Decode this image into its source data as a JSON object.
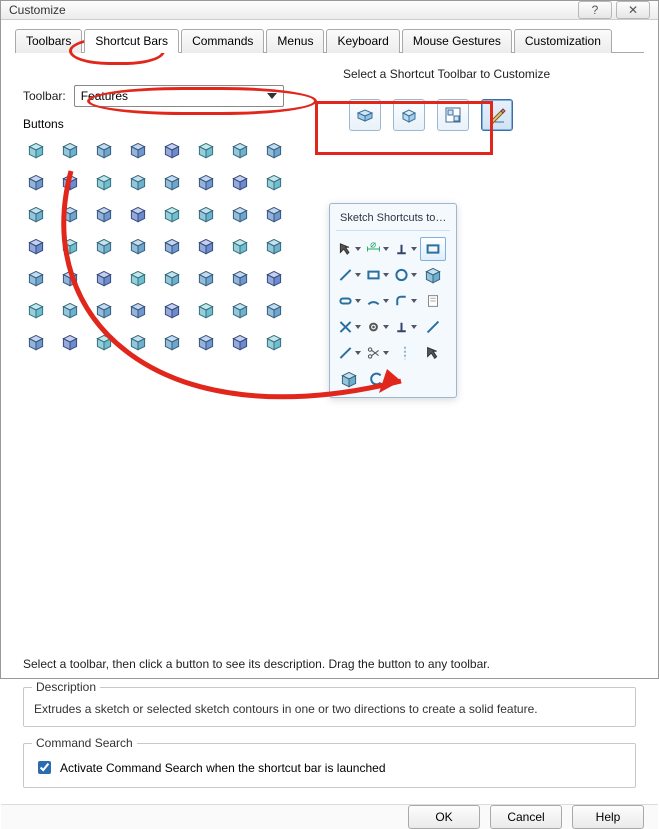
{
  "window": {
    "title": "Customize"
  },
  "tabs": [
    {
      "label": "Toolbars"
    },
    {
      "label": "Shortcut Bars"
    },
    {
      "label": "Commands"
    },
    {
      "label": "Menus"
    },
    {
      "label": "Keyboard"
    },
    {
      "label": "Mouse Gestures"
    },
    {
      "label": "Customization"
    }
  ],
  "active_tab_index": 1,
  "toolbar_select": {
    "label": "Toolbar:",
    "value": "Features"
  },
  "right_panel": {
    "heading": "Select a Shortcut Toolbar to Customize",
    "buttons": [
      {
        "name": "assembly-icon"
      },
      {
        "name": "part-icon"
      },
      {
        "name": "drawing-icon"
      },
      {
        "name": "sketch-icon"
      }
    ],
    "selected_index": 3
  },
  "buttons_label": "Buttons",
  "button_icons": [
    "extrude",
    "revolve",
    "swept",
    "loft",
    "boundary",
    "thicken",
    "cut-extrude",
    "cut-revolve",
    "cut-sweep",
    "cut-loft",
    "cut-boundary",
    "hole",
    "fillet",
    "chamfer",
    "rib",
    "draft",
    "shell",
    "dome",
    "freeform",
    "deform",
    "indent",
    "flex",
    "wrap",
    "mirror",
    "pattern-linear",
    "pattern-circular",
    "pattern-curve",
    "pattern-sketch",
    "pattern-table",
    "pattern-fill",
    "move-face",
    "split",
    "scale",
    "combine",
    "intersect",
    "delete-face",
    "imported",
    "offset-surface",
    "ruled-surface",
    "repair",
    "reference-plane",
    "reference-axis",
    "reference-coord",
    "reference-point",
    "mate-ref",
    "live-section",
    "curves",
    "instant3d",
    "weldment",
    "structural",
    "trim-extend",
    "gusset",
    "end-cap",
    "check",
    "3dsketch-check",
    "grid3d"
  ],
  "sketch_panel": {
    "title": "Sketch Shortcuts tool...",
    "rows": [
      [
        "select-arrow",
        "dim-smart",
        "relations",
        "corner-rect"
      ],
      [
        "line",
        "rectangle",
        "circle",
        "cube"
      ],
      [
        "slot",
        "arc",
        "fillet-sketch",
        "sheet"
      ],
      [
        "trim",
        "gear",
        "perpendicular",
        "spline"
      ],
      [
        "spline2",
        "scissors",
        "axis",
        "up-arrow"
      ],
      [
        "cube2",
        "c-shape",
        "",
        ""
      ]
    ]
  },
  "hint_text": "Select a toolbar, then click a button to see its description. Drag the button to any toolbar.",
  "description": {
    "title": "Description",
    "text": "Extrudes a sketch or selected sketch contours in one or two directions to create a solid feature."
  },
  "command_search": {
    "title": "Command Search",
    "checkbox_label": "Activate Command Search when the shortcut bar is launched",
    "checked": true
  },
  "footer": {
    "ok": "OK",
    "cancel": "Cancel",
    "help": "Help"
  }
}
